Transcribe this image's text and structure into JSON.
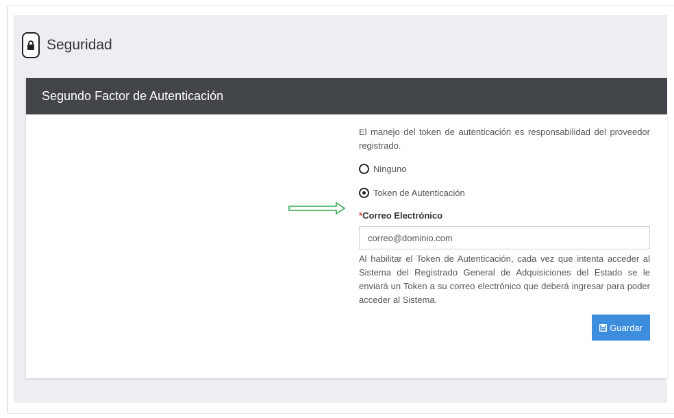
{
  "page": {
    "title": "Seguridad",
    "icon": "lock-icon"
  },
  "panel": {
    "heading": "Segundo Factor de Autenticación"
  },
  "form": {
    "info_text": "El manejo del token de autenticación es responsabilidad del proveedor registrado.",
    "options": [
      {
        "label": "Ninguno",
        "selected": false
      },
      {
        "label": "Token de Autenticación",
        "selected": true
      }
    ],
    "email": {
      "required_marker": "*",
      "label": "Correo Electrónico",
      "value": "correo@dominio.com"
    },
    "help_text": "Al habilitar el Token de Autenticación, cada vez que intenta acceder al Sistema del Registrado General de Adquisiciones del Estado se le enviará un Token a su correo electrónico que deberá ingresar para poder acceder al Sistema.",
    "save_label": "Guardar",
    "save_icon": "floppy-disk-icon"
  },
  "annotation": {
    "icon": "arrow-right-icon",
    "color": "#2fa84f"
  },
  "colors": {
    "panel_heading_bg": "#424549",
    "button_bg": "#3c8dde",
    "required": "#e04b3c",
    "page_bg": "#eceef1"
  }
}
